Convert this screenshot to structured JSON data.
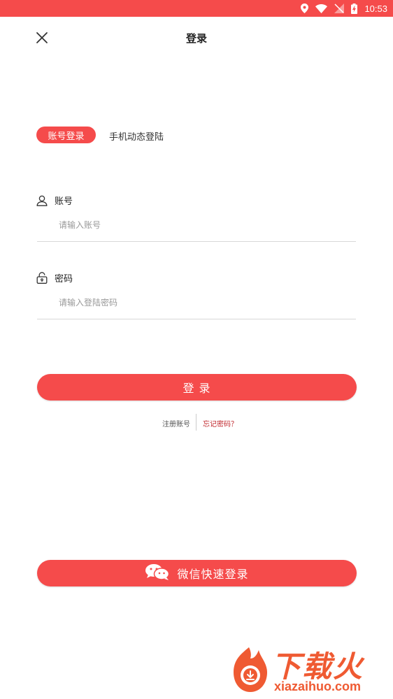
{
  "status_bar": {
    "time": "10:53",
    "icons": [
      "location-icon",
      "wifi-icon",
      "no-signal-icon",
      "battery-charging-icon"
    ],
    "color": "#f54b4b"
  },
  "header": {
    "title": "登录",
    "close_icon": "close-icon"
  },
  "tabs": [
    {
      "label": "账号登录",
      "active": true
    },
    {
      "label": "手机动态登陆",
      "active": false
    }
  ],
  "form": {
    "account": {
      "label": "账号",
      "placeholder": "请输入账号",
      "value": "",
      "icon": "user-icon"
    },
    "password": {
      "label": "密码",
      "placeholder": "请输入登陆密码",
      "value": "",
      "icon": "lock-icon"
    }
  },
  "login_button": {
    "label": "登 录"
  },
  "links": {
    "register": "注册账号",
    "forgot": "忘记密码？"
  },
  "wechat_button": {
    "label": "微信快速登录",
    "icon": "wechat-icon"
  },
  "watermark": {
    "text": "下载火",
    "url": "xiazaihuo.com"
  },
  "colors": {
    "accent": "#f54b4b",
    "forgot_link": "#c0282d",
    "watermark": "#ef5a32"
  }
}
